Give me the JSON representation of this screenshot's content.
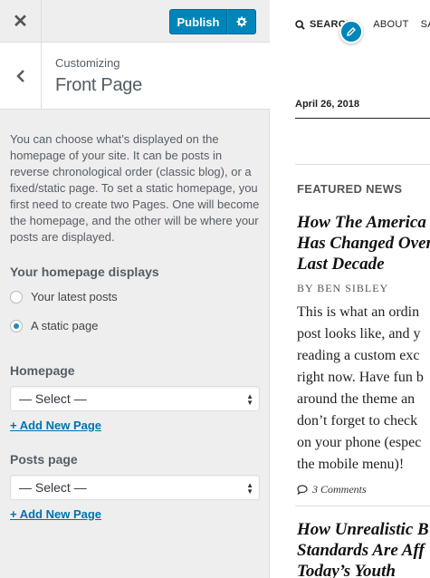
{
  "header": {
    "publish_label": "Publish"
  },
  "section": {
    "customizing_label": "Customizing",
    "title": "Front Page"
  },
  "description": "You can choose what’s displayed on the homepage of your site. It can be posts in reverse chronological order (classic blog), or a fixed/static page. To set a static homepage, you first need to create two Pages. One will become the homepage, and the other will be where your posts are displayed.",
  "homepage_displays": {
    "label": "Your homepage displays",
    "options": [
      {
        "label": "Your latest posts",
        "checked": false
      },
      {
        "label": "A static page",
        "checked": true
      }
    ]
  },
  "homepage": {
    "label": "Homepage",
    "selected": "— Select —",
    "add_link": "+ Add New Page"
  },
  "posts_page": {
    "label": "Posts page",
    "selected": "— Select —",
    "add_link": "+ Add New Page"
  },
  "preview": {
    "nav": [
      "SEARCH",
      "ABOUT",
      "SAM"
    ],
    "date": "April 26, 2018",
    "featured_label": "FEATURED NEWS",
    "post1": {
      "title_lines": [
        "How The America",
        "Has Changed Over",
        "Last Decade"
      ],
      "byline": "BY BEN SIBLEY",
      "excerpt_lines": [
        "This is what an ordin",
        "post looks like, and y",
        "reading a custom exc",
        "right now. Have fun b",
        "around the theme an",
        "don’t forget to check",
        "on your phone (espec",
        "the mobile menu)!"
      ],
      "comments": "3 Comments"
    },
    "post2": {
      "title_lines": [
        "How Unrealistic B",
        "Standards Are Aff",
        "Today’s Youth"
      ]
    }
  },
  "colors": {
    "accent": "#0085ba",
    "link": "#0073aa",
    "panel_bg": "#eeeeee",
    "date_rule": "#222222",
    "divider": "#dddddd"
  }
}
